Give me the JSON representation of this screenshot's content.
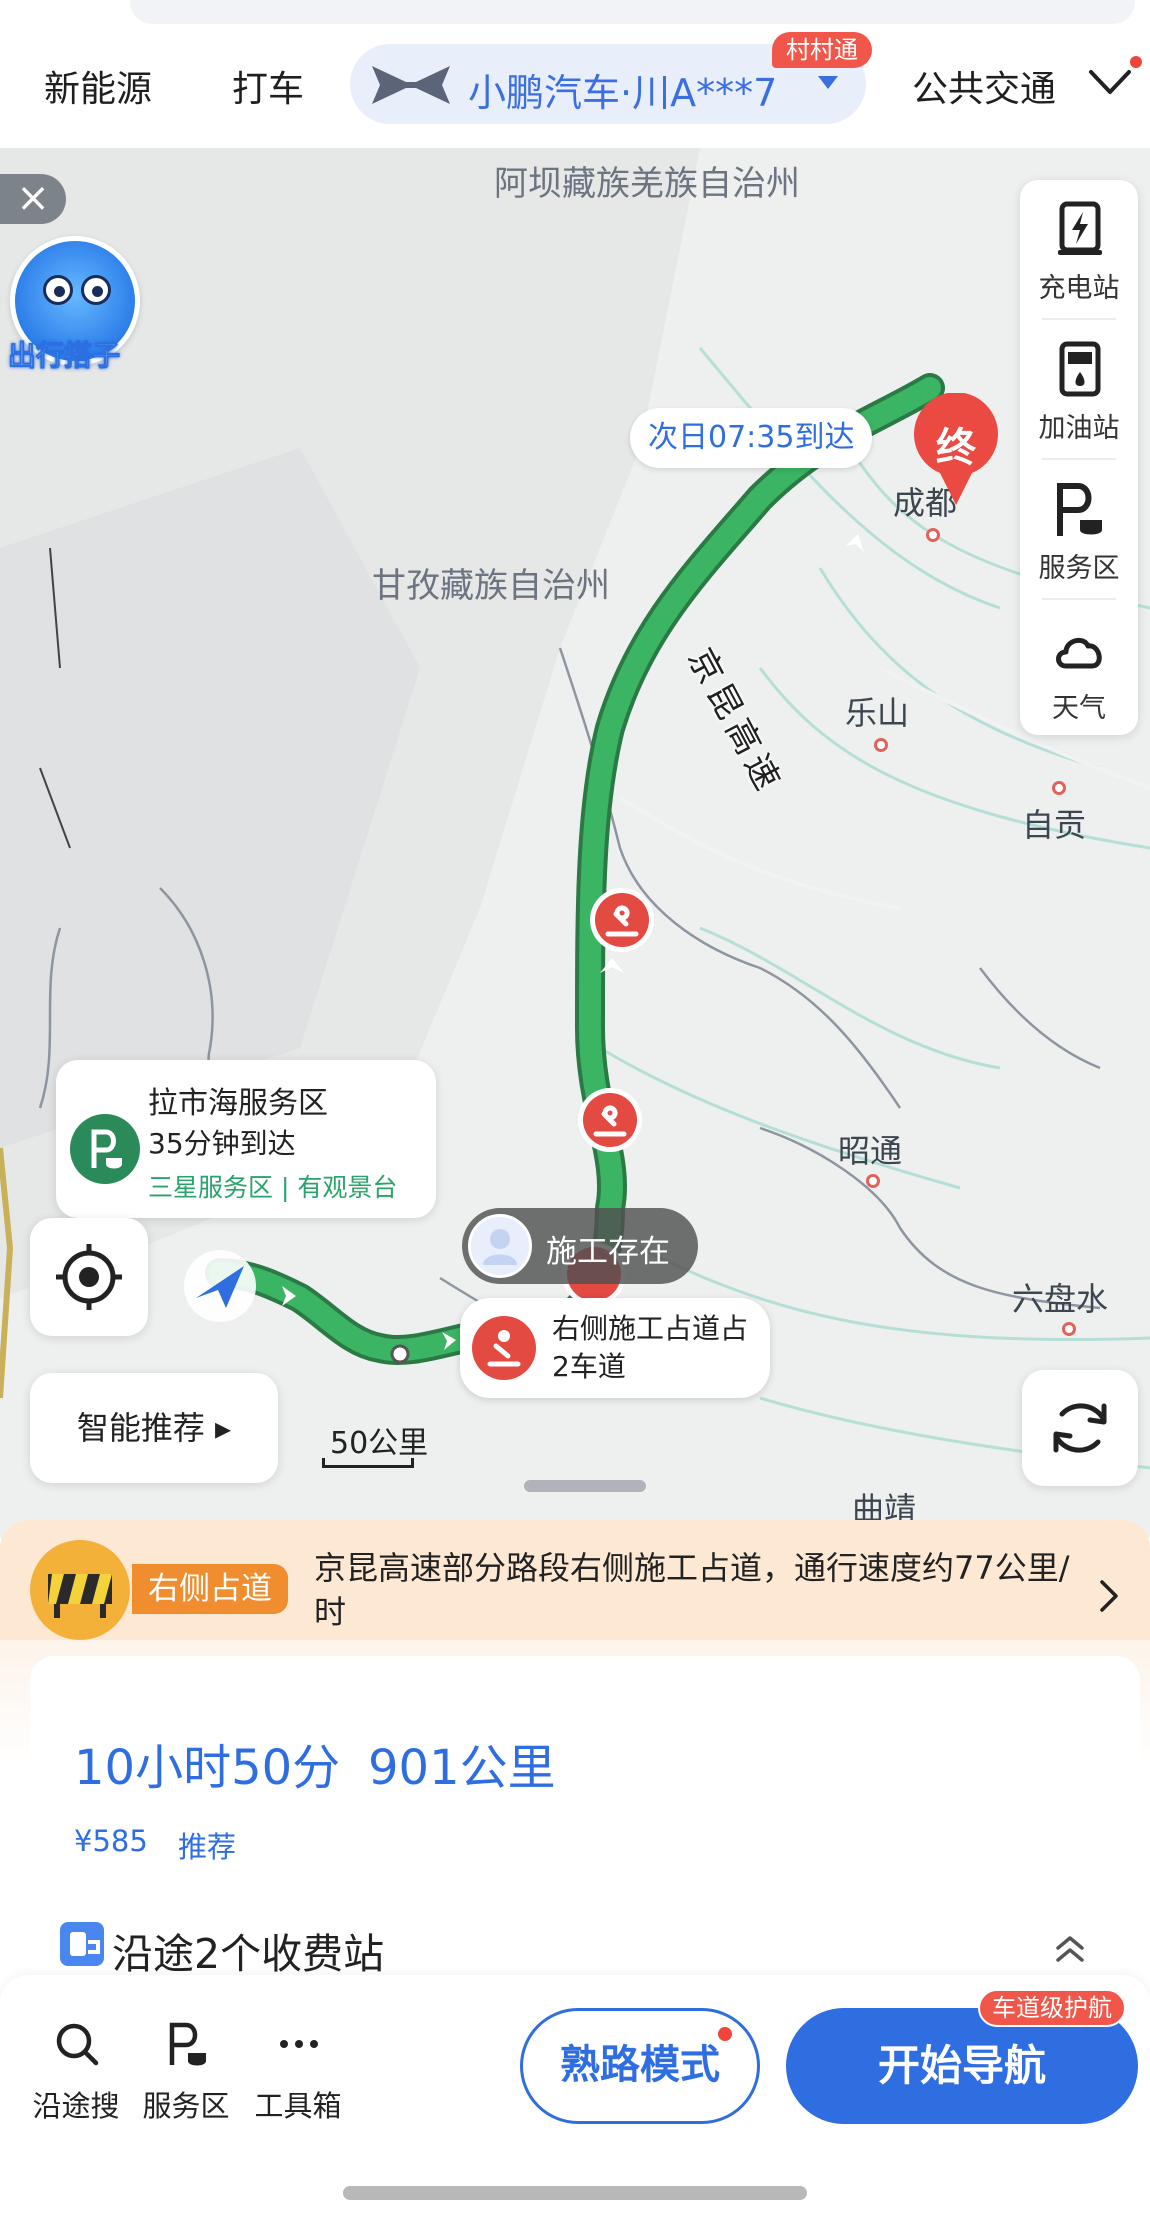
{
  "top_bar": {
    "tabs": [
      "新能源",
      "打车"
    ],
    "car_label": "小鹏汽车·川A***7",
    "car_badge": "村村通",
    "transit_tab": "公共交通"
  },
  "map": {
    "regions": [
      "阿坝藏族羌族自治州",
      "甘孜藏族自治州"
    ],
    "cities": [
      "成都",
      "乐山",
      "自贡",
      "昭通",
      "六盘水",
      "曲靖"
    ],
    "highway_label": "京昆高速",
    "mascot_label": "出行搭子",
    "eta_bubble": "次日07:35到达",
    "destination_marker": "终",
    "right_tools": [
      {
        "icon": "charging-station-icon",
        "label": "充电站"
      },
      {
        "icon": "gas-station-icon",
        "label": "加油站"
      },
      {
        "icon": "service-area-icon",
        "label": "服务区"
      },
      {
        "icon": "weather-icon",
        "label": "天气"
      }
    ],
    "service_area": {
      "name": "拉市海服务区",
      "eta": "35分钟到达",
      "tags": "三星服务区 | 有观景台"
    },
    "smart_recommend": "智能推荐 ▸",
    "scale": "50公里",
    "construction_bubble": "施工存在",
    "lane_bubble": "右侧施工占道占2车道"
  },
  "alert": {
    "badge": "右侧占道",
    "text": "京昆高速部分路段右侧施工占道，通行速度约77公里/时"
  },
  "route": {
    "time": "10小时50分",
    "distance": "901公里",
    "price": "¥585",
    "tag": "推荐",
    "tolls": "沿途2个收费站"
  },
  "bottom_bar": {
    "tools": [
      {
        "icon": "search-icon",
        "label": "沿途搜"
      },
      {
        "icon": "service-area-icon",
        "label": "服务区"
      },
      {
        "icon": "more-icon",
        "label": "工具箱"
      }
    ],
    "familiar_mode": "熟路模式",
    "start_nav": "开始导航",
    "lane_nav_badge": "车道级护航"
  },
  "colors": {
    "accent": "#2f6ee0",
    "route_green": "#3bb463",
    "alert_red": "#e24a42",
    "alert_orange": "#f08d2e"
  }
}
